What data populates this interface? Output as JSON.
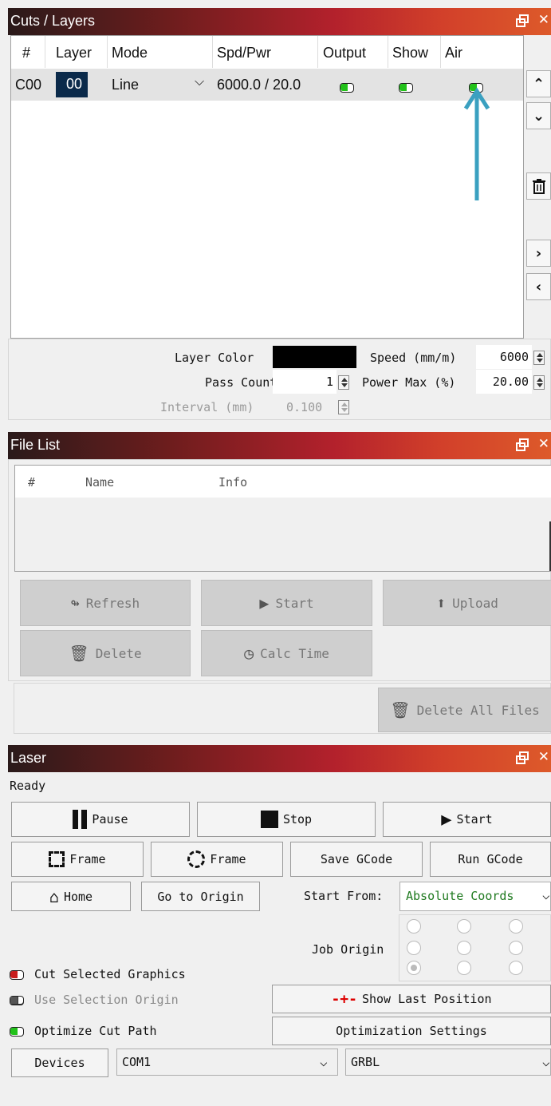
{
  "cuts_layers": {
    "title": "Cuts / Layers",
    "columns": [
      "#",
      "Layer",
      "Mode",
      "Spd/Pwr",
      "Output",
      "Show",
      "Air"
    ],
    "row": {
      "id": "C00",
      "layer": "00",
      "mode": "Line",
      "spd_pwr": "6000.0 / 20.0",
      "output": true,
      "show": true,
      "air": true
    },
    "layer_color_label": "Layer Color",
    "layer_color": "#000000",
    "pass_count_label": "Pass Count",
    "pass_count": "1",
    "interval_label": "Interval (mm)",
    "interval": "0.100",
    "speed_label": "Speed (mm/m)",
    "speed": "6000",
    "power_max_label": "Power Max (%)",
    "power_max": "20.00"
  },
  "file_list": {
    "title": "File List",
    "columns": [
      "#",
      "Name",
      "Info"
    ],
    "refresh": "Refresh",
    "start": "Start",
    "upload": "Upload",
    "delete": "Delete",
    "calc_time": "Calc Time",
    "delete_all": "Delete All Files"
  },
  "laser": {
    "title": "Laser",
    "status": "Ready",
    "pause": "Pause",
    "stop": "Stop",
    "start": "Start",
    "frame_rect": "Frame",
    "frame_circle": "Frame",
    "save_gcode": "Save GCode",
    "run_gcode": "Run GCode",
    "home": "Home",
    "go_to_origin": "Go to Origin",
    "start_from_label": "Start From:",
    "start_from": "Absolute Coords",
    "job_origin_label": "Job Origin",
    "cut_selected": "Cut Selected Graphics",
    "use_selection_origin": "Use Selection Origin",
    "optimize_cut_path": "Optimize Cut Path",
    "show_last_position": "Show Last Position",
    "optimization_settings": "Optimization Settings",
    "devices": "Devices",
    "port": "COM1",
    "controller": "GRBL"
  },
  "colors": {
    "accent_green": "#22c21a",
    "toggle_red": "#c81e1e",
    "arrow": "#3aa0c0",
    "layer_chip": "#0b2a4a"
  }
}
